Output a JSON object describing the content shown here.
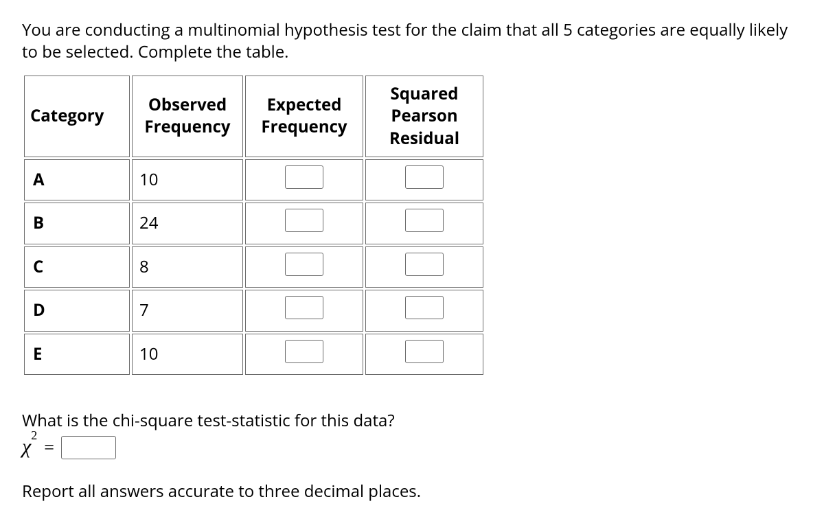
{
  "intro": "You are conducting a multinomial hypothesis test for the claim that all 5 categories are equally likely to be selected. Complete the table.",
  "headers": {
    "category": "Category",
    "observed": "Observed Frequency",
    "expected": "Expected Frequency",
    "squared": "Squared Pearson Residual"
  },
  "rows": [
    {
      "category": "A",
      "observed": "10"
    },
    {
      "category": "B",
      "observed": "24"
    },
    {
      "category": "C",
      "observed": "8"
    },
    {
      "category": "D",
      "observed": "7"
    },
    {
      "category": "E",
      "observed": "10"
    }
  ],
  "question2": "What is the chi-square test-statistic for this data?",
  "chi_label": "χ",
  "chi_exp": "2",
  "equals": "=",
  "note": "Report all answers accurate to three decimal places."
}
